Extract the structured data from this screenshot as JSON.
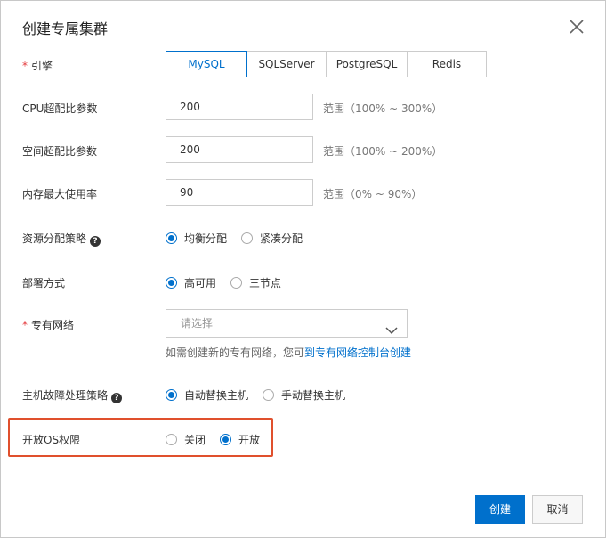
{
  "dialog": {
    "title": "创建专属集群",
    "close_icon": "close-icon"
  },
  "engine": {
    "required_mark": "*",
    "label": "引擎",
    "options": [
      "MySQL",
      "SQLServer",
      "PostgreSQL",
      "Redis"
    ],
    "selected": "MySQL"
  },
  "cpu": {
    "label": "CPU超配比参数",
    "value": "200",
    "range": "范围（100% ~ 300%）"
  },
  "space": {
    "label": "空间超配比参数",
    "value": "200",
    "range": "范围（100% ~ 200%）"
  },
  "memory": {
    "label": "内存最大使用率",
    "value": "90",
    "range": "范围（0% ~ 90%）"
  },
  "allocation": {
    "label": "资源分配策略",
    "help_icon": "question-circle-icon",
    "help_glyph": "?",
    "options": [
      "均衡分配",
      "紧凑分配"
    ],
    "selected": "均衡分配"
  },
  "deploy": {
    "label": "部署方式",
    "options": [
      "高可用",
      "三节点"
    ],
    "selected": "高可用"
  },
  "vpc": {
    "required_mark": "*",
    "label": "专有网络",
    "placeholder": "请选择",
    "hint_prefix": "如需创建新的专有网络，您可",
    "hint_link": "到专有网络控制台创建"
  },
  "failover": {
    "label": "主机故障处理策略",
    "help_icon": "question-circle-icon",
    "help_glyph": "?",
    "options": [
      "自动替换主机",
      "手动替换主机"
    ],
    "selected": "自动替换主机"
  },
  "os_permission": {
    "label": "开放OS权限",
    "options": [
      "关闭",
      "开放"
    ],
    "selected": "开放"
  },
  "footer": {
    "create_label": "创建",
    "cancel_label": "取消"
  },
  "colors": {
    "accent": "#0070cc",
    "highlight": "#e0502d"
  }
}
